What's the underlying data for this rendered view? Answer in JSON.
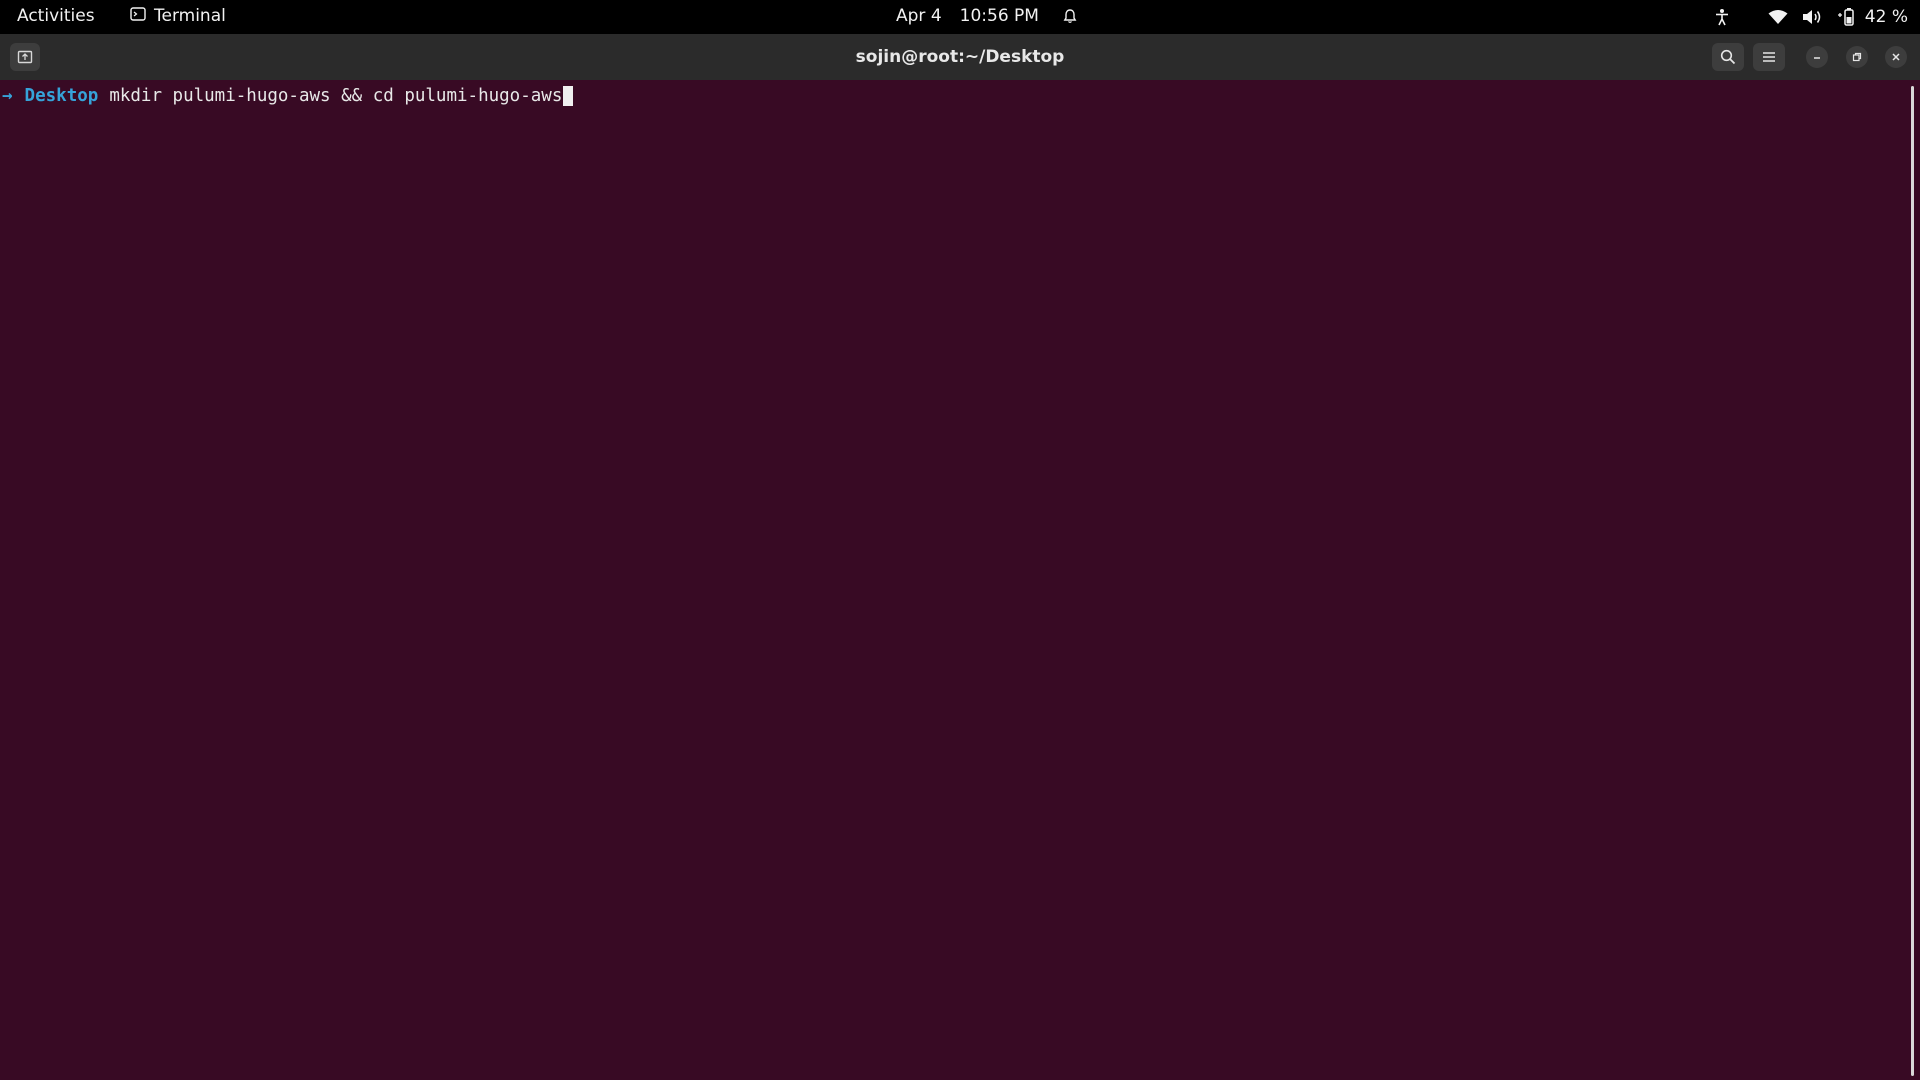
{
  "topbar": {
    "activities_label": "Activities",
    "app_name": "Terminal",
    "date": "Apr 4",
    "time": "10:56 PM",
    "battery_percent": "42 %"
  },
  "window": {
    "title": "sojin@root:~/Desktop"
  },
  "terminal": {
    "prompt_symbol": "→",
    "cwd": "Desktop",
    "command": "mkdir pulumi-hugo-aws && cd pulumi-hugo-aws"
  },
  "colors": {
    "terminal_bg": "#380a24",
    "prompt_accent": "#36a3d9",
    "topbar_bg": "#000000",
    "headerbar_bg": "#2b2b2b"
  },
  "icons": {
    "app_menu": "terminal-icon",
    "clock_extra": "alarm-icon",
    "tray": [
      "accessibility-icon",
      "wifi-icon",
      "volume-icon",
      "battery-icon"
    ],
    "headerbar": [
      "new-tab-icon",
      "search-icon",
      "hamburger-menu-icon",
      "minimize-icon",
      "maximize-icon",
      "close-icon"
    ]
  }
}
